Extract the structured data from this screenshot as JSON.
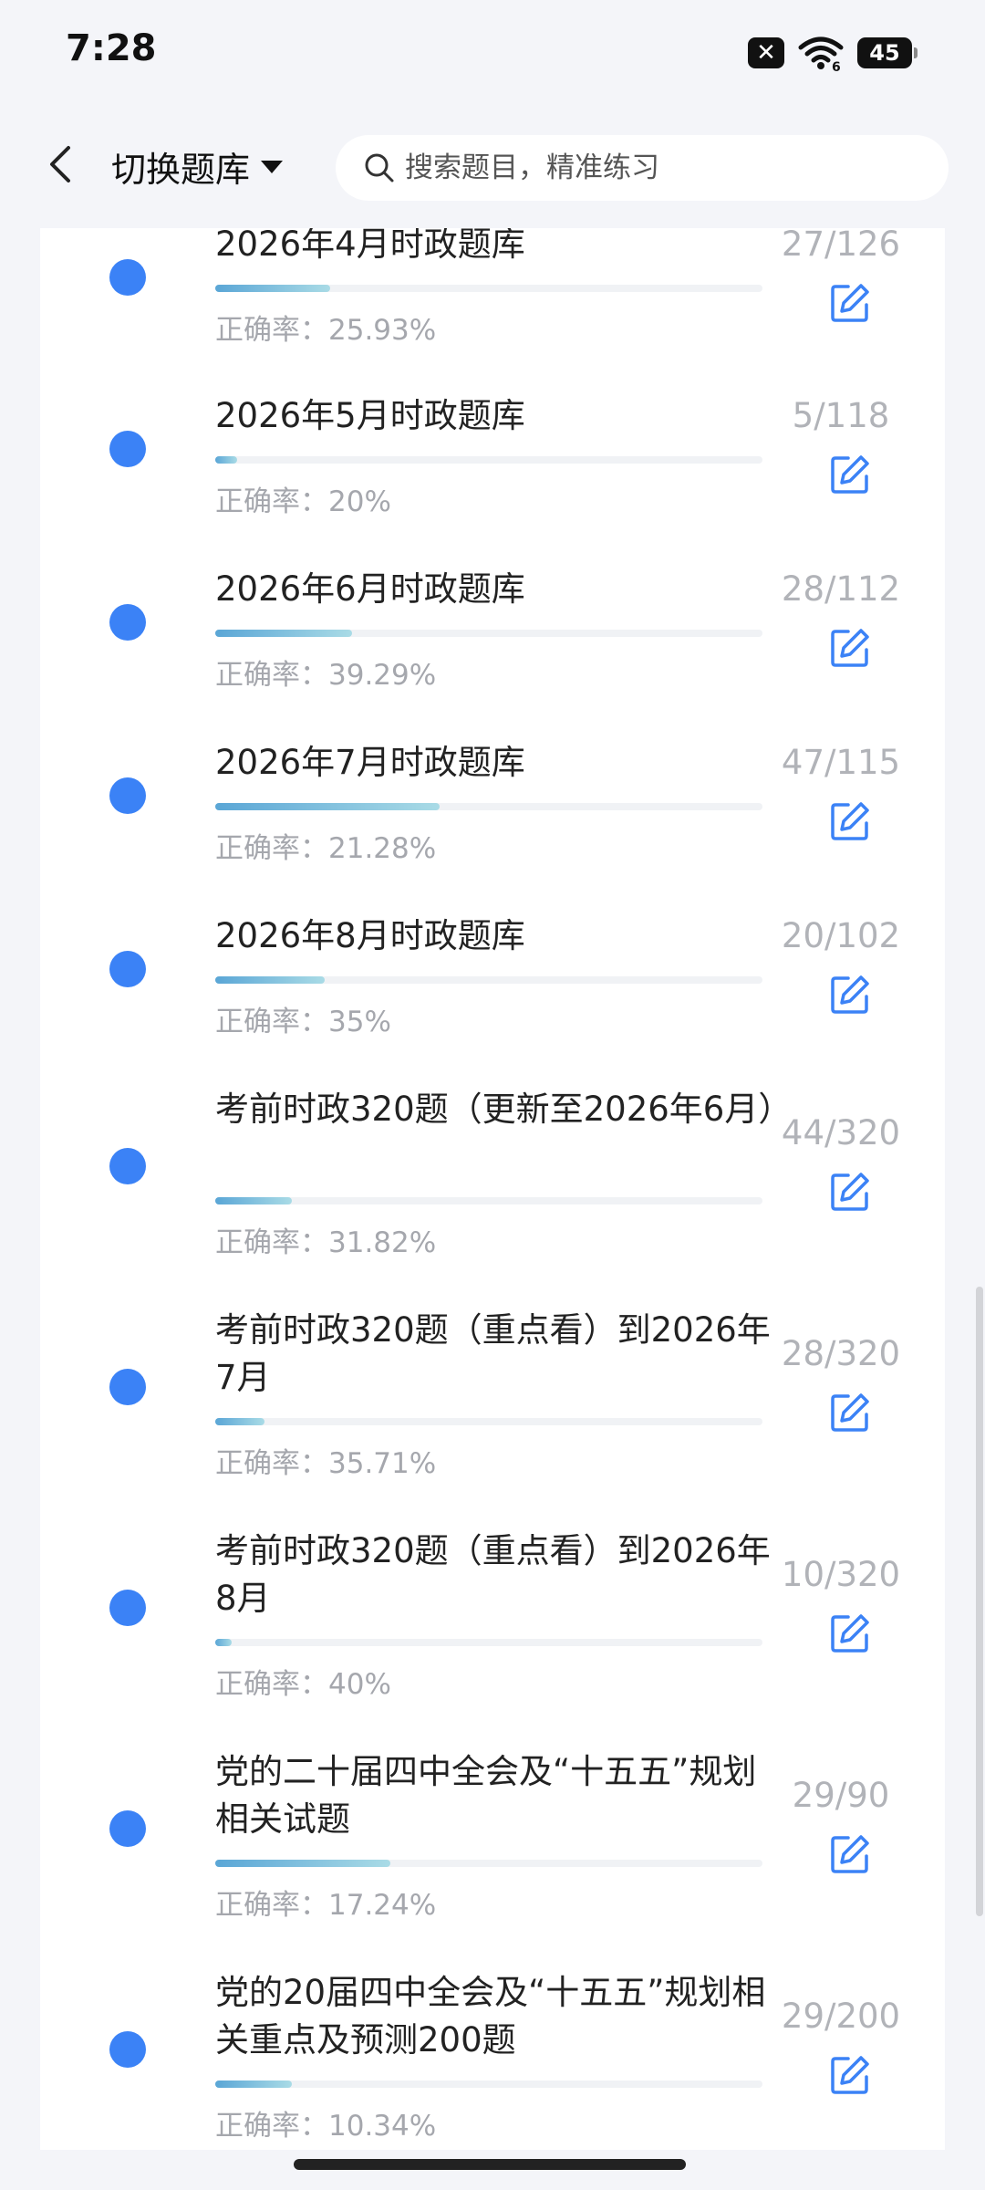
{
  "status_bar": {
    "time": "7:28",
    "sim_icon": "sim-disabled-icon",
    "wifi_icon": "wifi-6-icon",
    "battery_level": "45"
  },
  "header": {
    "back_icon": "chevron-left-icon",
    "switch_label": "切换题库",
    "search_placeholder": "搜索题目，精准练习"
  },
  "colors": {
    "accent": "#3b82f6",
    "progress_start": "#5aa6d6",
    "progress_end": "#a9dbe6",
    "muted_text": "#a5a7ad"
  },
  "items": [
    {
      "title": "2026年4月时政题库",
      "accuracy_label": "正确率：",
      "accuracy": "25.93%",
      "done": "27/126",
      "progress": 0.21
    },
    {
      "title": "2026年5月时政题库",
      "accuracy_label": "正确率：",
      "accuracy": "20%",
      "done": "5/118",
      "progress": 0.04
    },
    {
      "title": "2026年6月时政题库",
      "accuracy_label": "正确率：",
      "accuracy": "39.29%",
      "done": "28/112",
      "progress": 0.25
    },
    {
      "title": "2026年7月时政题库",
      "accuracy_label": "正确率：",
      "accuracy": "21.28%",
      "done": "47/115",
      "progress": 0.41
    },
    {
      "title": "2026年8月时政题库",
      "accuracy_label": "正确率：",
      "accuracy": "35%",
      "done": "20/102",
      "progress": 0.2
    },
    {
      "title": "考前时政320题（更新至2026年6月）",
      "accuracy_label": "正确率：",
      "accuracy": "31.82%",
      "done": "44/320",
      "progress": 0.14
    },
    {
      "title": "考前时政320题（重点看）到2026年7月",
      "accuracy_label": "正确率：",
      "accuracy": "35.71%",
      "done": "28/320",
      "progress": 0.09
    },
    {
      "title": "考前时政320题（重点看）到2026年8月",
      "accuracy_label": "正确率：",
      "accuracy": "40%",
      "done": "10/320",
      "progress": 0.03
    },
    {
      "title": "党的二十届四中全会及“十五五”规划相关试题",
      "accuracy_label": "正确率：",
      "accuracy": "17.24%",
      "done": "29/90",
      "progress": 0.32
    },
    {
      "title": "党的20届四中全会及“十五五”规划相关重点及预测200题",
      "accuracy_label": "正确率：",
      "accuracy": "10.34%",
      "done": "29/200",
      "progress": 0.14
    }
  ]
}
